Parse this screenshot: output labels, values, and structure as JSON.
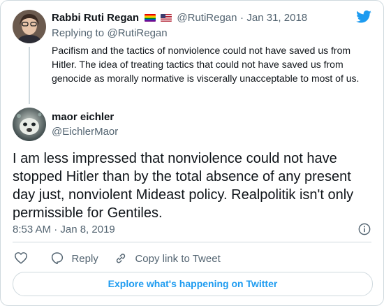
{
  "parent_tweet": {
    "author_name": "Rabbi Ruti Regan",
    "flags": [
      "rainbow-flag-icon",
      "us-flag-icon"
    ],
    "handle": "@RutiRegan",
    "separator": "·",
    "date": "Jan 31, 2018",
    "replying_prefix": "Replying to",
    "replying_to": "@RutiRegan",
    "text": "Pacifism and the tactics of nonviolence could not have saved us from Hitler. The idea of treating tactics that could not have saved us from genocide as morally normative is viscerally unacceptable to most of us."
  },
  "main_tweet": {
    "author_name": "maor eichler",
    "handle": "@EichlerMaor",
    "text": "I am less impressed that nonviolence could not have stopped Hitler than by the total absence of any present day just, nonviolent Mideast policy. Realpolitik isn't only permissible for Gentiles.",
    "timestamp": "8:53 AM · Jan 8, 2019"
  },
  "actions": {
    "like_icon": "heart-icon",
    "reply_label": "Reply",
    "copy_link_label": "Copy link to Tweet"
  },
  "explore_label": "Explore what's happening on Twitter",
  "colors": {
    "accent": "#1d9bf0",
    "muted": "#536471",
    "border": "#cfd9de"
  }
}
